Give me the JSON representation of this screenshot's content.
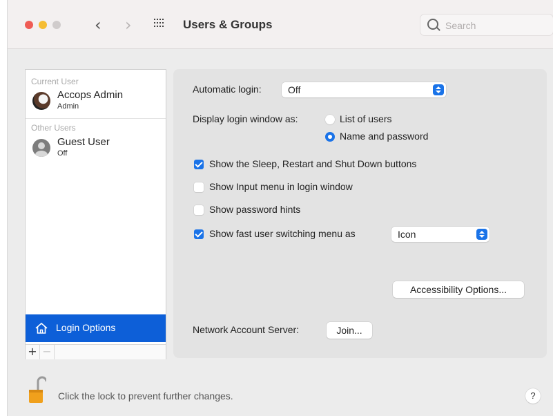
{
  "window": {
    "title": "Users & Groups",
    "search_placeholder": "Search"
  },
  "sidebar": {
    "current_user_label": "Current User",
    "other_users_label": "Other Users",
    "users": [
      {
        "name": "Accops Admin",
        "role": "Admin"
      },
      {
        "name": "Guest User",
        "role": "Off"
      }
    ],
    "login_options_label": "Login Options",
    "add_label": "+",
    "remove_label": "−"
  },
  "panel": {
    "automatic_login_label": "Automatic login:",
    "automatic_login_value": "Off",
    "display_login_label": "Display login window as:",
    "radio_list_label": "List of users",
    "radio_name_label": "Name and password",
    "selected_display": "Name and password",
    "cb_sleep_label": "Show the Sleep, Restart and Shut Down buttons",
    "cb_sleep_checked": true,
    "cb_input_label": "Show Input menu in login window",
    "cb_input_checked": false,
    "cb_hints_label": "Show password hints",
    "cb_hints_checked": false,
    "cb_fast_label": "Show fast user switching menu as",
    "cb_fast_checked": true,
    "fast_switch_value": "Icon",
    "accessibility_button": "Accessibility Options...",
    "network_label": "Network Account Server:",
    "join_button": "Join..."
  },
  "footer": {
    "lock_text": "Click the lock to prevent further changes.",
    "help_label": "?"
  },
  "colors": {
    "accent": "#1a73e8",
    "selection": "#0d5fd8",
    "lock": "#f0a01c"
  }
}
